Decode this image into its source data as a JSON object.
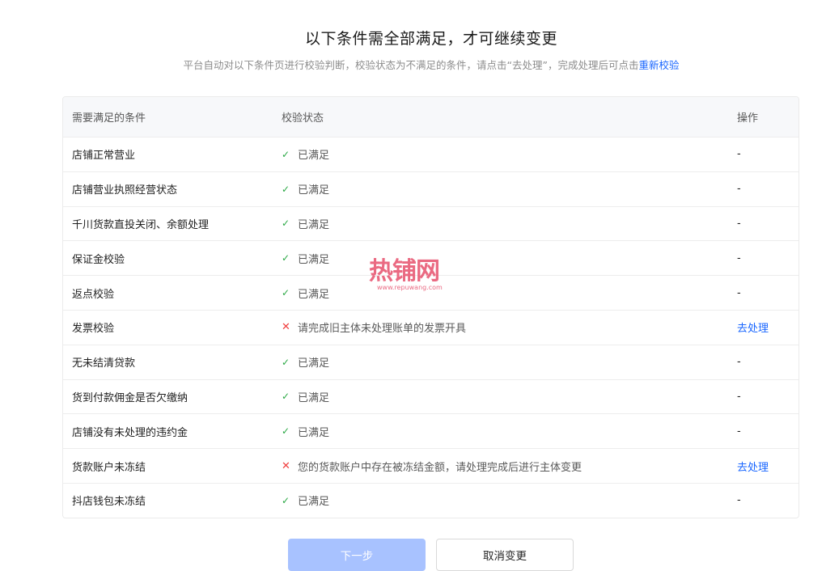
{
  "header": {
    "title": "以下条件需全部满足，才可继续变更",
    "subtitle": "平台自动对以下条件页进行校验判断，校验状态为不满足的条件，请点击“去处理”，完成处理后可点击",
    "recheck_link": "重新校验"
  },
  "table": {
    "columns": [
      "需要满足的条件",
      "校验状态",
      "操作"
    ],
    "rows": [
      {
        "condition": "店铺正常营业",
        "status": "已满足",
        "ok": true,
        "action": "-"
      },
      {
        "condition": "店铺营业执照经营状态",
        "status": "已满足",
        "ok": true,
        "action": "-"
      },
      {
        "condition": "千川货款直投关闭、余额处理",
        "status": "已满足",
        "ok": true,
        "action": "-"
      },
      {
        "condition": "保证金校验",
        "status": "已满足",
        "ok": true,
        "action": "-"
      },
      {
        "condition": "返点校验",
        "status": "已满足",
        "ok": true,
        "action": "-"
      },
      {
        "condition": "发票校验",
        "status": "请完成旧主体未处理账单的发票开具",
        "ok": false,
        "action": "去处理"
      },
      {
        "condition": "无未结清贷款",
        "status": "已满足",
        "ok": true,
        "action": "-"
      },
      {
        "condition": "货到付款佣金是否欠缴纳",
        "status": "已满足",
        "ok": true,
        "action": "-"
      },
      {
        "condition": "店铺没有未处理的违约金",
        "status": "已满足",
        "ok": true,
        "action": "-"
      },
      {
        "condition": "货款账户未冻结",
        "status": "您的货款账户中存在被冻结金额，请处理完成后进行主体变更",
        "ok": false,
        "action": "去处理"
      },
      {
        "condition": "抖店钱包未冻结",
        "status": "已满足",
        "ok": true,
        "action": "-"
      }
    ]
  },
  "icons": {
    "ok": "check-icon",
    "bad": "cross-icon"
  },
  "watermark": {
    "text": "热铺网",
    "url": "www.repuwang.com"
  },
  "footer": {
    "next_label": "下一步",
    "cancel_label": "取消变更"
  },
  "colors": {
    "link": "#1966ff",
    "ok": "#2aa844",
    "bad": "#f03e3e",
    "next_disabled": "#a8c2ff"
  }
}
